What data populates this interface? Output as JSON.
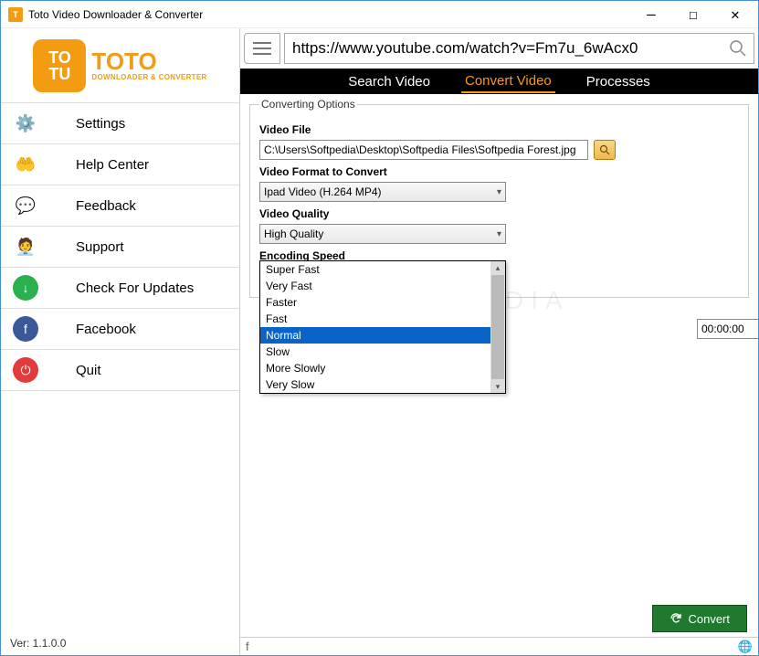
{
  "window": {
    "title": "Toto Video Downloader & Converter"
  },
  "logo": {
    "square_text": "TO\nTU",
    "brand": "TOTO",
    "subtitle": "DOWNLOADER & CONVERTER"
  },
  "sidebar": {
    "items": [
      {
        "label": "Settings"
      },
      {
        "label": "Help Center"
      },
      {
        "label": "Feedback"
      },
      {
        "label": "Support"
      },
      {
        "label": "Check For Updates"
      },
      {
        "label": "Facebook"
      },
      {
        "label": "Quit"
      }
    ],
    "version": "Ver: 1.1.0.0"
  },
  "urlbar": {
    "value": "https://www.youtube.com/watch?v=Fm7u_6wAcx0"
  },
  "tabs": {
    "items": [
      {
        "label": "Search Video"
      },
      {
        "label": "Convert Video",
        "active": true
      },
      {
        "label": "Processes"
      }
    ]
  },
  "form": {
    "legend": "Converting Options",
    "video_file_label": "Video File",
    "video_file_value": "C:\\Users\\Softpedia\\Desktop\\Softpedia Files\\Softpedia Forest.jpg",
    "video_format_label": "Video Format to Convert",
    "video_format_value": "Ipad Video (H.264 MP4)",
    "video_quality_label": "Video Quality",
    "video_quality_value": "High Quality",
    "encoding_speed_label": "Encoding Speed",
    "encoding_speed_value": "Normal",
    "encoding_speed_options": [
      "Super Fast",
      "Very Fast",
      "Faster",
      "Fast",
      "Normal",
      "Slow",
      "More Slowly",
      "Very Slow"
    ],
    "time_value": "00:00:00"
  },
  "actions": {
    "convert": "Convert"
  },
  "watermark": "SOFTPEDIA"
}
